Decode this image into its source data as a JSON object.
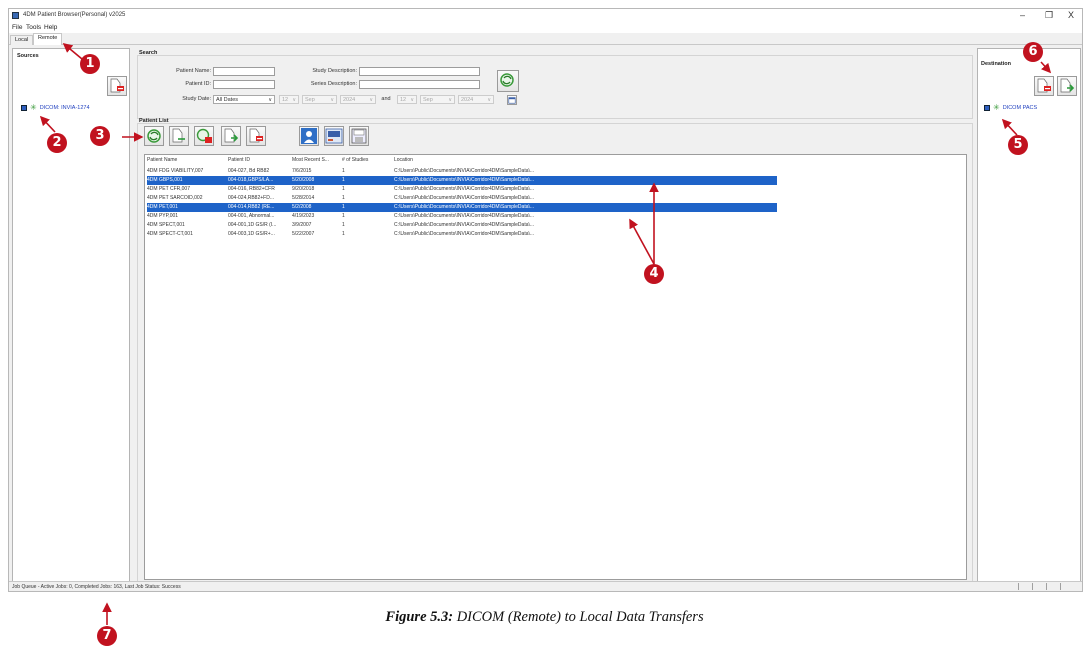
{
  "window": {
    "title": "4DM Patient Browser(Personal) v2025",
    "minimize": "–",
    "maximize": "❐",
    "close": "X"
  },
  "menu": [
    "File",
    "Tools",
    "Help"
  ],
  "tabs": [
    {
      "label": "Local",
      "active": false
    },
    {
      "label": "Remote",
      "active": true
    }
  ],
  "sources": {
    "title": "Sources",
    "items": [
      {
        "label": "DICOM: INVIA-1274",
        "icon": "dicom-node-icon"
      }
    ]
  },
  "destination": {
    "title": "Destination",
    "items": [
      {
        "label": "DICOM PACS",
        "icon": "dicom-node-icon"
      }
    ]
  },
  "search": {
    "title": "Search",
    "patient_name_label": "Patient Name:",
    "patient_name_value": "",
    "patient_id_label": "Patient ID:",
    "patient_id_value": "",
    "study_description_label": "Study Description:",
    "study_description_value": "",
    "series_description_label": "Series Description:",
    "series_description_value": "",
    "study_date_label": "Study Date:",
    "date_mode": "All Dates",
    "from_day": "12",
    "from_month": "Sep",
    "from_year": "2024",
    "and_label": "and",
    "to_day": "12",
    "to_month": "Sep",
    "to_year": "2024"
  },
  "patient_list": {
    "title": "Patient List",
    "columns": [
      "Patient Name",
      "Patient ID",
      "Most Recent S...",
      "# of Studies",
      "Location"
    ],
    "rows": [
      {
        "name": "4DM FDG VIABILITY,007",
        "id": "004-027, Bd RB82",
        "date": "7/6/2015",
        "studies": "1",
        "location": "C:\\Users\\Public\\Documents\\INVIA\\Corridor4DM\\SampleData\\...",
        "selected": false
      },
      {
        "name": "4DM GBPS,001",
        "id": "004-018,GBPS/LA...",
        "date": "5/20/2008",
        "studies": "1",
        "location": "C:\\Users\\Public\\Documents\\INVIA\\Corridor4DM\\SampleData\\...",
        "selected": true
      },
      {
        "name": "4DM PET CFR,007",
        "id": "004-016, RB82+CFR",
        "date": "9/20/2018",
        "studies": "1",
        "location": "C:\\Users\\Public\\Documents\\INVIA\\Corridor4DM\\SampleData\\...",
        "selected": false
      },
      {
        "name": "4DM PET SARCOID,002",
        "id": "004-024,RB82+FD...",
        "date": "5/28/2014",
        "studies": "1",
        "location": "C:\\Users\\Public\\Documents\\INVIA\\Corridor4DM\\SampleData\\...",
        "selected": false
      },
      {
        "name": "4DM PET,001",
        "id": "004-014,RB82 (RE...",
        "date": "5/2/2008",
        "studies": "1",
        "location": "C:\\Users\\Public\\Documents\\INVIA\\Corridor4DM\\SampleData\\...",
        "selected": true
      },
      {
        "name": "4DM PYP,001",
        "id": "004-001, Abnormal...",
        "date": "4/19/2023",
        "studies": "1",
        "location": "C:\\Users\\Public\\Documents\\INVIA\\Corridor4DM\\SampleData\\...",
        "selected": false
      },
      {
        "name": "4DM SPECT,001",
        "id": "004-001,1D GS/R (I...",
        "date": "3/9/2007",
        "studies": "1",
        "location": "C:\\Users\\Public\\Documents\\INVIA\\Corridor4DM\\SampleData\\...",
        "selected": false
      },
      {
        "name": "4DM SPECT-CT,001",
        "id": "004-003,1D GS/R+...",
        "date": "5/22/2007",
        "studies": "1",
        "location": "C:\\Users\\Public\\Documents\\INVIA\\Corridor4DM\\SampleData\\...",
        "selected": false
      }
    ]
  },
  "status": {
    "text": "Job Queue - Active Jobs: 0, Completed Jobs: 163, Last Job Status: Success"
  },
  "annotations": [
    "1",
    "2",
    "3",
    "4",
    "5",
    "6",
    "7"
  ],
  "caption": {
    "figure_label": "Figure 5.3:",
    "text": "DICOM (Remote) to Local Data Transfers"
  },
  "colors": {
    "selection": "#1e63c8",
    "annotation": "#c1121f",
    "tree_text": "#1f3fbf"
  }
}
